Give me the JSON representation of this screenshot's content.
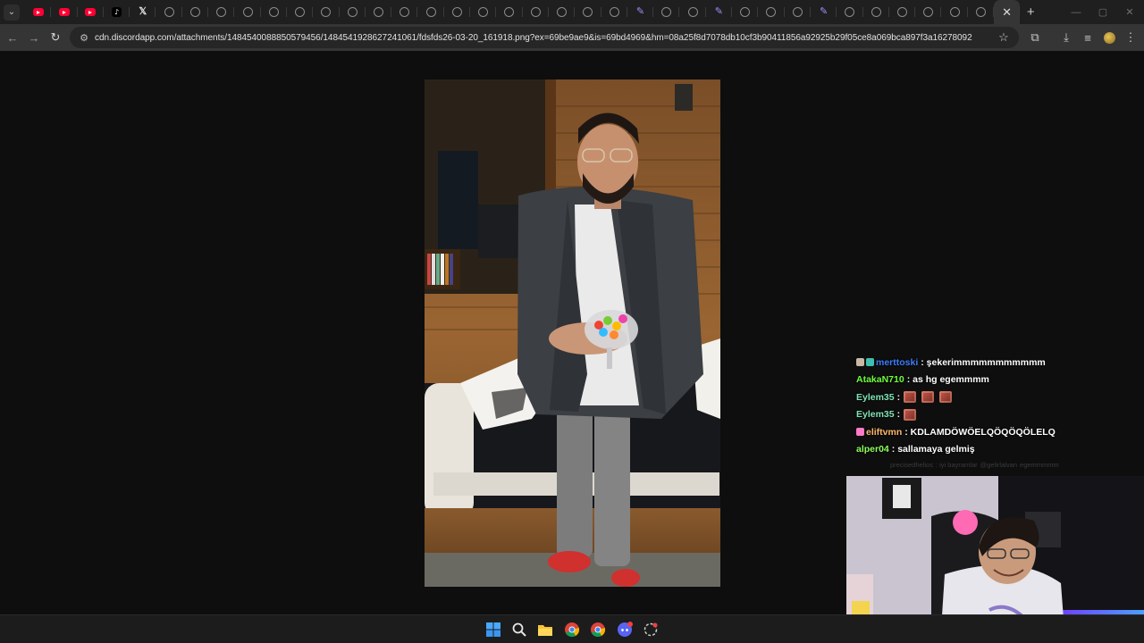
{
  "browser": {
    "tabs": [
      {
        "icon": "youtube-icon"
      },
      {
        "icon": "youtube-icon"
      },
      {
        "icon": "youtube-icon"
      },
      {
        "icon": "tiktok-icon",
        "glyph": "♪"
      },
      {
        "icon": "x-icon",
        "glyph": "𝕏"
      },
      {
        "icon": "globe-icon"
      },
      {
        "icon": "globe-icon"
      },
      {
        "icon": "globe-icon"
      },
      {
        "icon": "globe-icon"
      },
      {
        "icon": "globe-icon"
      },
      {
        "icon": "globe-icon"
      },
      {
        "icon": "globe-icon"
      },
      {
        "icon": "globe-icon"
      },
      {
        "icon": "globe-icon"
      },
      {
        "icon": "globe-icon"
      },
      {
        "icon": "globe-icon"
      },
      {
        "icon": "globe-icon"
      },
      {
        "icon": "globe-icon"
      },
      {
        "icon": "globe-icon"
      },
      {
        "icon": "globe-icon"
      },
      {
        "icon": "globe-icon"
      },
      {
        "icon": "globe-icon"
      },
      {
        "icon": "globe-icon"
      },
      {
        "icon": "pen-icon"
      },
      {
        "icon": "globe-icon"
      },
      {
        "icon": "globe-icon"
      },
      {
        "icon": "pen-icon"
      },
      {
        "icon": "globe-icon"
      },
      {
        "icon": "globe-icon"
      },
      {
        "icon": "globe-icon"
      },
      {
        "icon": "pen-icon"
      },
      {
        "icon": "globe-icon"
      },
      {
        "icon": "globe-icon"
      },
      {
        "icon": "globe-icon"
      },
      {
        "icon": "globe-icon"
      },
      {
        "icon": "globe-icon"
      },
      {
        "icon": "globe-icon"
      }
    ],
    "active_tab_close": "✕",
    "new_tab": "+",
    "url": "cdn.discordapp.com/attachments/1484540088850579456/1484541928627241061/fdsfds26-03-20_161918.png?ex=69be9ae9&is=69bd4969&hm=08a25f8d7078db10cf3b90411856a92925b29f05ce8a069bca897f3a16278092"
  },
  "chat": {
    "messages": [
      {
        "user": "merttoski",
        "user_color": "#3b7cff",
        "badges": [
          "#c9b8a6",
          "#3fbfae"
        ],
        "text": ": şekerimmmmmmmmmmm"
      },
      {
        "user": "AtakaN710",
        "user_color": "#6eff3b",
        "badges": [],
        "text": ": as hg egemmmm"
      },
      {
        "user": "Eylem35",
        "user_color": "#7fe3b4",
        "badges": [],
        "text": ":",
        "emotes": 3
      },
      {
        "user": "Eylem35",
        "user_color": "#7fe3b4",
        "badges": [],
        "text": ":",
        "emotes": 1
      },
      {
        "user": "eliftvmn",
        "user_color": "#ffb86b",
        "badges": [
          "#ff7ac8"
        ],
        "text": ": KDLAMDÖWÖELQÖQÖQÖLELQ"
      },
      {
        "user": "alper04",
        "user_color": "#8cff5a",
        "badges": [],
        "text": ": sallamaya gelmiş"
      }
    ],
    "faded_line": {
      "user_a": "precisedhelios",
      "text_a": ": iyi bayramlar",
      "user_b": "@gelirlalvan",
      "text_b": "egemmmmm"
    }
  },
  "colors": {
    "tabstrip_bg": "#1f1f1f",
    "toolbar_bg": "#353535",
    "viewer_bg": "#0e0e0e",
    "taskbar_bg": "#1c1c1c"
  }
}
